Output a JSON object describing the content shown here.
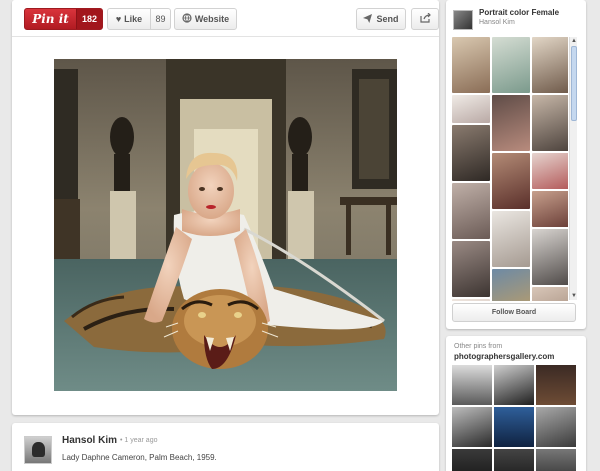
{
  "actions": {
    "pin_it_label": "Pin it",
    "pin_count": "182",
    "like_label": "Like",
    "like_count": "89",
    "website_label": "Website",
    "send_label": "Send"
  },
  "icons": {
    "like": "heart-icon",
    "website": "globe-icon",
    "send": "paper-plane-icon",
    "share": "share-icon",
    "scroll_up": "chevron-up-icon",
    "scroll_down": "chevron-down-icon"
  },
  "colors": {
    "pin_red": "#cb2027",
    "background": "#e9e9e9"
  },
  "comment": {
    "author": "Hansol Kim",
    "time": "• 1 year ago",
    "description": "Lady Daphne Cameron, Palm Beach, 1959."
  },
  "board": {
    "title": "Portrait color Female",
    "owner": "Hansol Kim",
    "follow_label": "Follow Board"
  },
  "other_pins": {
    "label": "Other pins from",
    "source": "photographersgallery.com"
  }
}
